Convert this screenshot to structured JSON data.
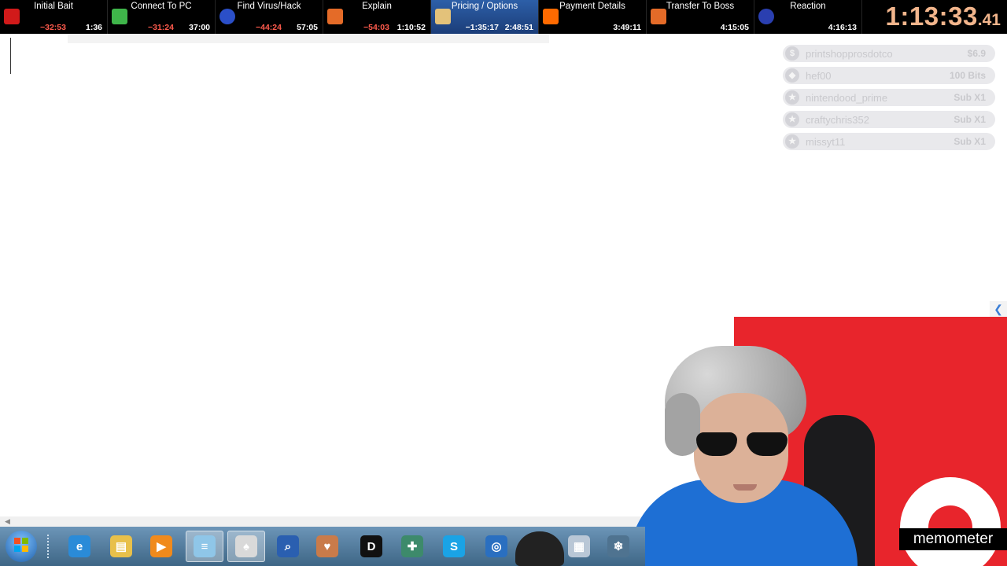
{
  "splits": [
    {
      "name": "Initial Bait",
      "delta": "−32:53",
      "time": "1:36",
      "delta_color": "#ff5b4d",
      "current": false,
      "icon": "red-flag-icon"
    },
    {
      "name": "Connect To PC",
      "delta": "−31:24",
      "time": "37:00",
      "delta_color": "#ff5b4d",
      "current": false,
      "icon": "green-shield-icon"
    },
    {
      "name": "Find Virus/Hack",
      "delta": "−44:24",
      "time": "57:05",
      "delta_color": "#ff5b4d",
      "current": false,
      "icon": "virus-icon"
    },
    {
      "name": "Explain",
      "delta": "−54:03",
      "time": "1:10:52",
      "delta_color": "#ff5b4d",
      "current": false,
      "icon": "card-icon"
    },
    {
      "name": "Pricing / Options",
      "delta": "−1:35:17",
      "time": "2:48:51",
      "delta_color": "#ffffff",
      "current": true,
      "icon": "money-hand-icon"
    },
    {
      "name": "Payment Details",
      "delta": "",
      "time": "3:49:11",
      "delta_color": "#ffffff",
      "current": false,
      "icon": "fire-icon"
    },
    {
      "name": "Transfer To Boss",
      "delta": "",
      "time": "4:15:05",
      "delta_color": "#ffffff",
      "current": false,
      "icon": "card-icon"
    },
    {
      "name": "Reaction",
      "delta": "",
      "time": "4:16:13",
      "delta_color": "#ffffff",
      "current": false,
      "icon": "face-icon"
    }
  ],
  "timer": {
    "main": "1:13:33",
    "fraction": ".41",
    "color": "#f2b58c"
  },
  "events": [
    {
      "name": "printshopprosdotco",
      "amount": "$6.9",
      "icon": "$"
    },
    {
      "name": "hef00",
      "amount": "100 Bits",
      "icon": "◆"
    },
    {
      "name": "nintendood_prime",
      "amount": "Sub X1",
      "icon": "★"
    },
    {
      "name": "craftychris352",
      "amount": "Sub X1",
      "icon": "★"
    },
    {
      "name": "missyt11",
      "amount": "Sub X1",
      "icon": "★"
    }
  ],
  "overlay": {
    "brand": "memometer",
    "accent": "#e8252c"
  },
  "taskbar": {
    "items": [
      {
        "name": "internet-explorer-icon",
        "glyph": "e",
        "color": "#2a8bd8",
        "active": false
      },
      {
        "name": "folder-icon",
        "glyph": "▤",
        "color": "#e8c04a",
        "active": false
      },
      {
        "name": "media-player-icon",
        "glyph": "▶",
        "color": "#f08a1c",
        "active": false
      },
      {
        "name": "notepad-icon",
        "glyph": "≡",
        "color": "#8fc6e8",
        "active": true
      },
      {
        "name": "solitaire-icon",
        "glyph": "♠",
        "color": "#d9d9d9",
        "active": true
      },
      {
        "name": "search-document-icon",
        "glyph": "⌕",
        "color": "#2a5fb0",
        "active": false
      },
      {
        "name": "cards-icon",
        "glyph": "♥",
        "color": "#c97b4a",
        "active": false
      },
      {
        "name": "dell-icon",
        "glyph": "D",
        "color": "#111111",
        "active": false
      },
      {
        "name": "support-icon",
        "glyph": "✚",
        "color": "#3d8a6b",
        "active": false
      },
      {
        "name": "skype-icon",
        "glyph": "S",
        "color": "#1aa3e6",
        "active": false
      },
      {
        "name": "globe-icon",
        "glyph": "◎",
        "color": "#2a6fc0",
        "active": false
      },
      {
        "name": "calculator-icon",
        "glyph": "▦",
        "color": "#b9c7d6",
        "active": false
      },
      {
        "name": "snowflake-icon",
        "glyph": "❄",
        "color": "#4f7390",
        "active": false
      }
    ]
  }
}
